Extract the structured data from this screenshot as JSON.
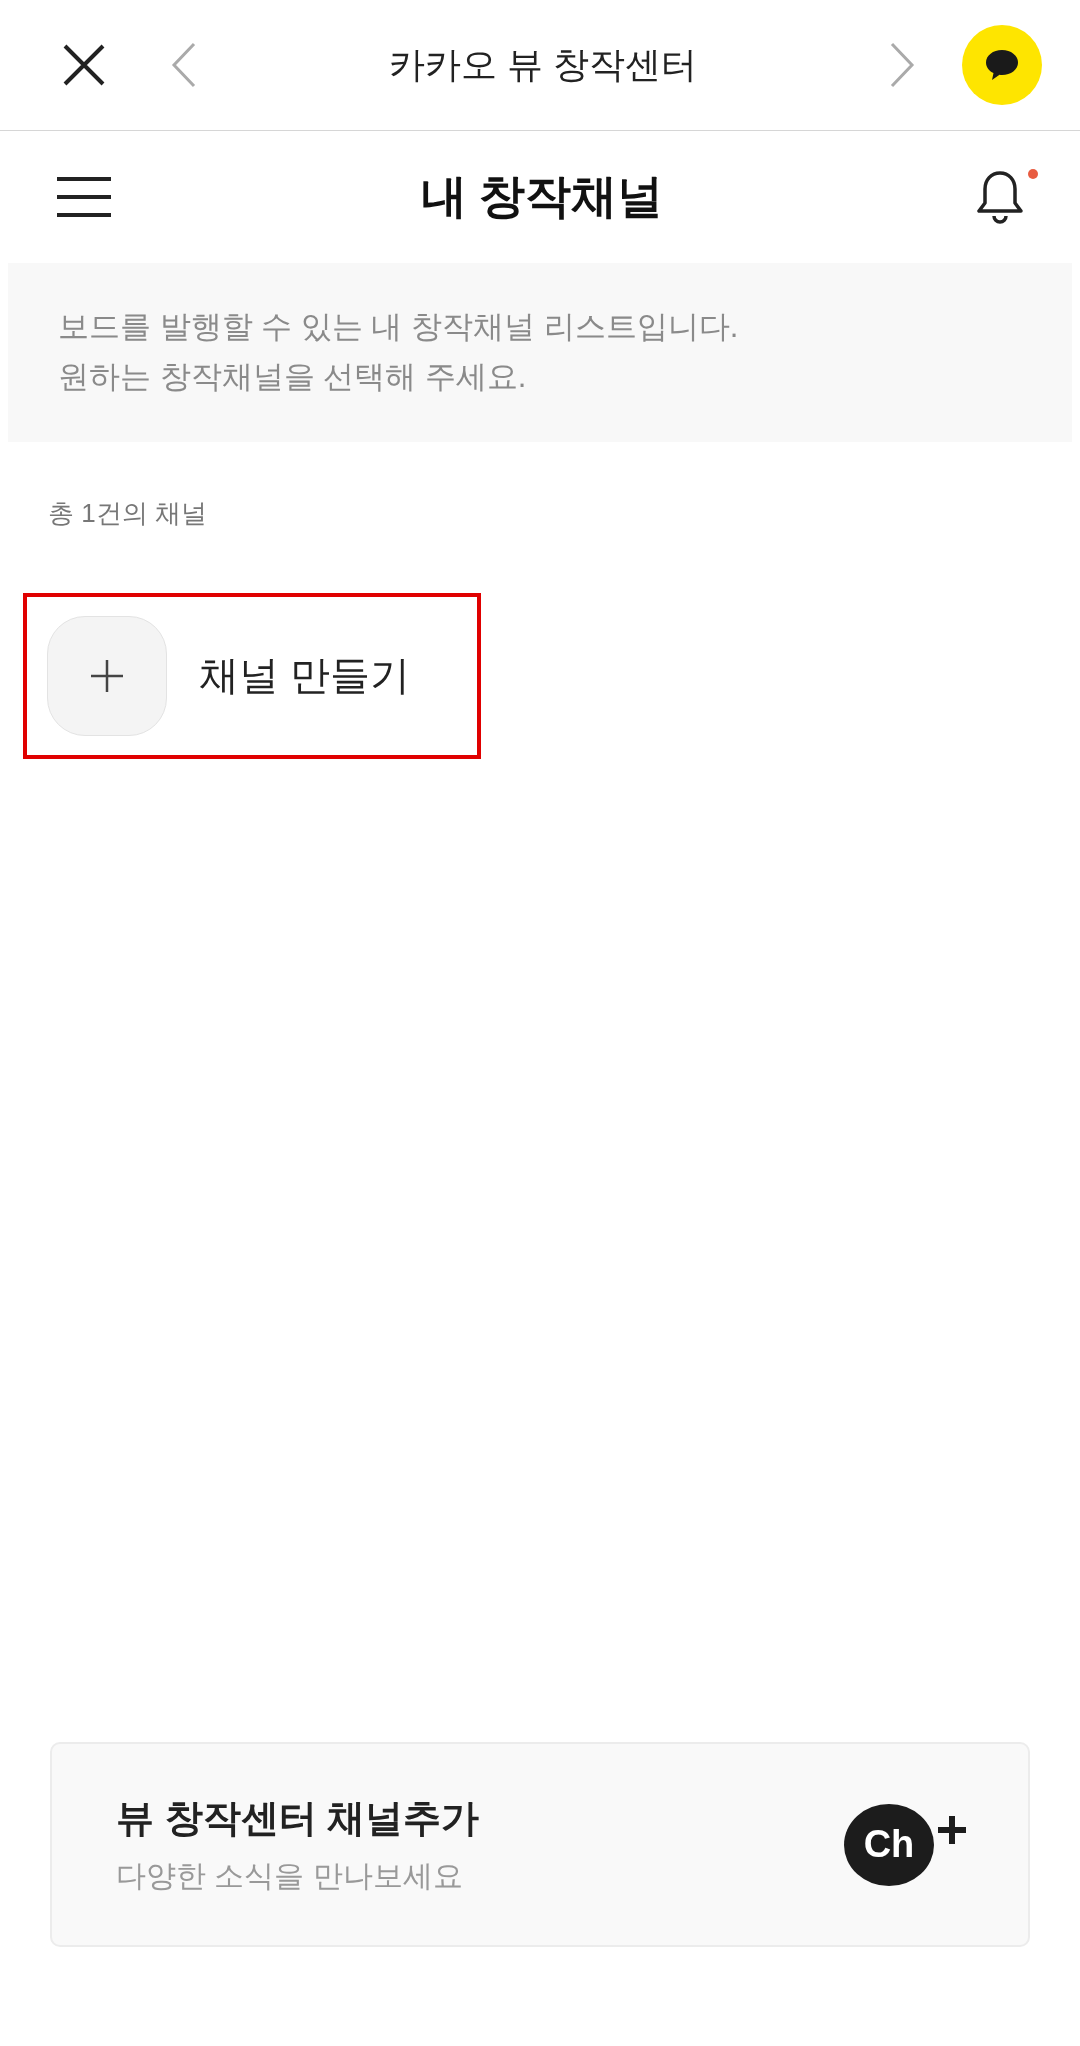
{
  "top_bar": {
    "title": "카카오 뷰 창작센터",
    "back_disabled": true,
    "forward_disabled": true
  },
  "header": {
    "title": "내 창작채널",
    "has_new_notification": true
  },
  "notice": {
    "lines": [
      "보드를 발행할 수 있는 내 창작채널 리스트입니다.",
      "원하는 창작채널을 선택해 주세요."
    ]
  },
  "count": "총 1건의 채널",
  "create_channel": {
    "label": "채널 만들기",
    "highlighted": true
  },
  "channel_add_card": {
    "title": "뷰 창작센터 채널추가",
    "subtitle": "다양한 소식을 만나보세요",
    "badge": "Ch"
  }
}
